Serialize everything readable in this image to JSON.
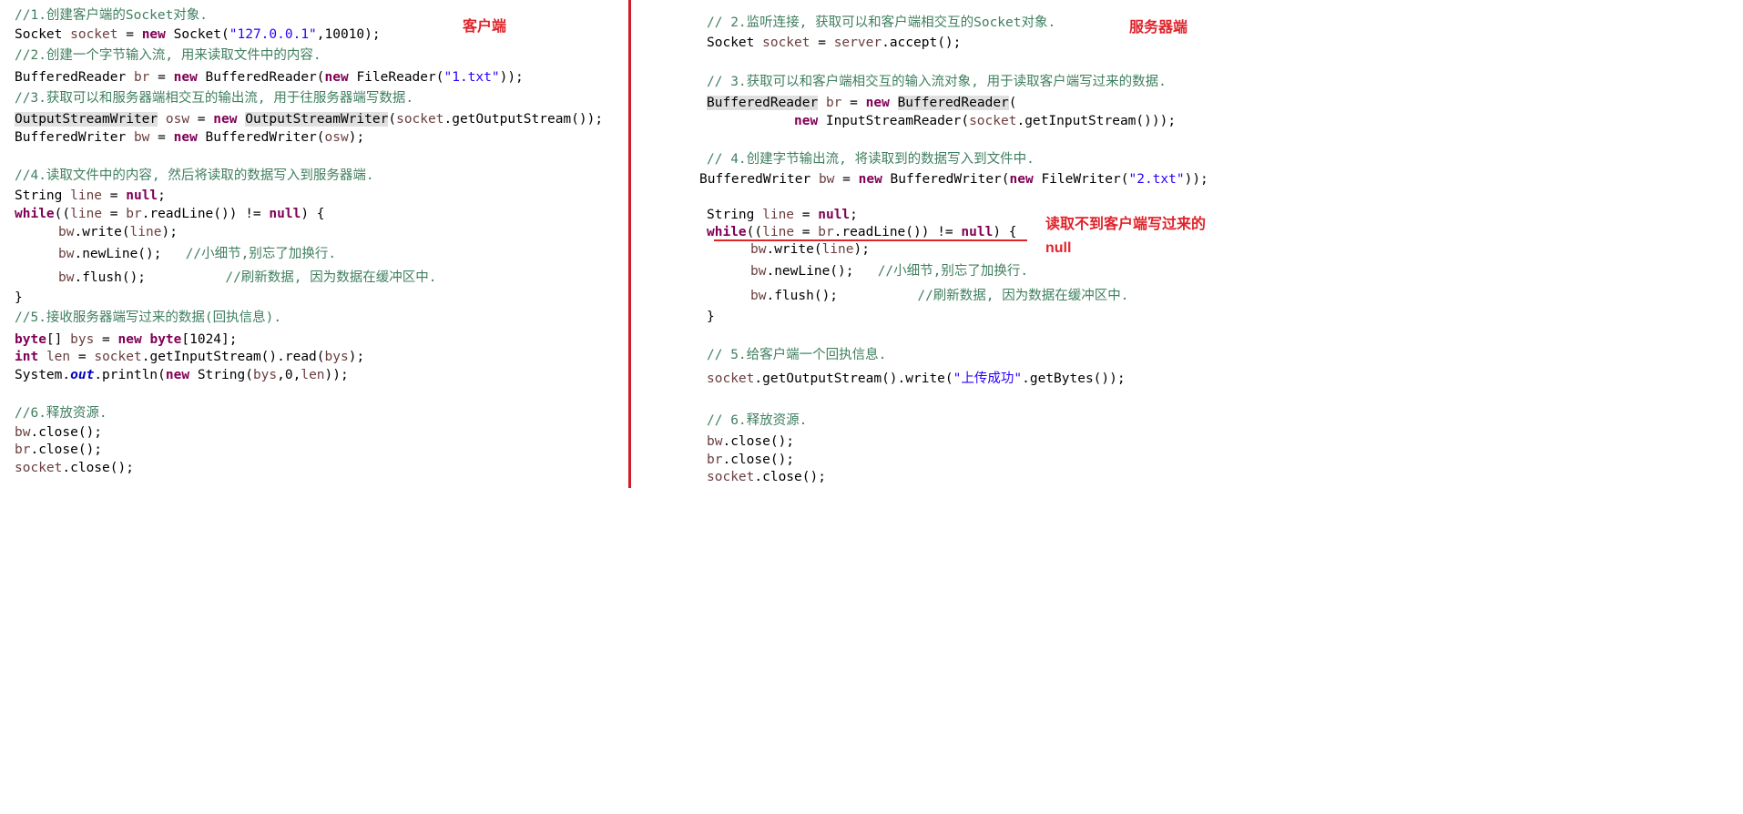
{
  "labels": {
    "client": "客户端",
    "server": "服务器端",
    "server_note": "读取不到客户端写过来的 null"
  },
  "colors": {
    "annotation": "#e0232b",
    "divider": "#d11b2a",
    "comment": "#3f7f5f",
    "keyword": "#7f0055",
    "string": "#2a00ff",
    "variable": "#6a3e3e",
    "static_field": "#0000c0"
  },
  "client_lines": [
    {
      "tokens": [
        {
          "t": "//1.创建客户端的Socket对象.",
          "c": "c"
        }
      ]
    },
    {
      "tokens": [
        {
          "t": "Socket ",
          "c": "p"
        },
        {
          "t": "socket",
          "c": "v"
        },
        {
          "t": " = ",
          "c": "p"
        },
        {
          "t": "new",
          "c": "k"
        },
        {
          "t": " Socket(",
          "c": "p"
        },
        {
          "t": "\"127.0.0.1\"",
          "c": "s"
        },
        {
          "t": ",10010);",
          "c": "p"
        }
      ]
    },
    {
      "tokens": [
        {
          "t": "//2.创建一个字节输入流, 用来读取文件中的内容.",
          "c": "c"
        }
      ]
    },
    {
      "tokens": [
        {
          "t": "BufferedReader ",
          "c": "p"
        },
        {
          "t": "br",
          "c": "v"
        },
        {
          "t": " = ",
          "c": "p"
        },
        {
          "t": "new",
          "c": "k"
        },
        {
          "t": " BufferedReader(",
          "c": "p"
        },
        {
          "t": "new",
          "c": "k"
        },
        {
          "t": " FileReader(",
          "c": "p"
        },
        {
          "t": "\"1.txt\"",
          "c": "s"
        },
        {
          "t": "));",
          "c": "p"
        }
      ]
    },
    {
      "tokens": [
        {
          "t": "//3.获取可以和服务器端相交互的输出流, 用于往服务器端写数据.",
          "c": "c"
        }
      ]
    },
    {
      "tokens": [
        {
          "t": "OutputStreamWriter",
          "c": "hl"
        },
        {
          "t": " ",
          "c": "p"
        },
        {
          "t": "osw",
          "c": "v"
        },
        {
          "t": " = ",
          "c": "p"
        },
        {
          "t": "new",
          "c": "k"
        },
        {
          "t": " ",
          "c": "p"
        },
        {
          "t": "OutputStreamWriter",
          "c": "hl"
        },
        {
          "t": "(",
          "c": "p"
        },
        {
          "t": "socket",
          "c": "v"
        },
        {
          "t": ".getOutputStream());",
          "c": "p"
        }
      ]
    },
    {
      "tokens": [
        {
          "t": "BufferedWriter ",
          "c": "p"
        },
        {
          "t": "bw",
          "c": "v"
        },
        {
          "t": " = ",
          "c": "p"
        },
        {
          "t": "new",
          "c": "k"
        },
        {
          "t": " BufferedWriter(",
          "c": "p"
        },
        {
          "t": "osw",
          "c": "v"
        },
        {
          "t": ");",
          "c": "p"
        }
      ]
    },
    {
      "tokens": [
        {
          "t": "//4.读取文件中的内容, 然后将读取的数据写入到服务器端.",
          "c": "c"
        }
      ]
    },
    {
      "tokens": [
        {
          "t": "String ",
          "c": "p"
        },
        {
          "t": "line",
          "c": "v"
        },
        {
          "t": " = ",
          "c": "p"
        },
        {
          "t": "null",
          "c": "k"
        },
        {
          "t": ";",
          "c": "p"
        }
      ]
    },
    {
      "tokens": [
        {
          "t": "while",
          "c": "k"
        },
        {
          "t": "((",
          "c": "p"
        },
        {
          "t": "line",
          "c": "v"
        },
        {
          "t": " = ",
          "c": "p"
        },
        {
          "t": "br",
          "c": "v"
        },
        {
          "t": ".readLine()) != ",
          "c": "p"
        },
        {
          "t": "null",
          "c": "k"
        },
        {
          "t": ") {",
          "c": "p"
        }
      ]
    },
    {
      "tokens": [
        {
          "t": "bw",
          "c": "v"
        },
        {
          "t": ".write(",
          "c": "p"
        },
        {
          "t": "line",
          "c": "v"
        },
        {
          "t": ");",
          "c": "p"
        }
      ]
    },
    {
      "tokens": [
        {
          "t": "bw",
          "c": "v"
        },
        {
          "t": ".newLine();   ",
          "c": "p"
        },
        {
          "t": "//小细节,别忘了加换行.",
          "c": "c"
        }
      ]
    },
    {
      "tokens": [
        {
          "t": "bw",
          "c": "v"
        },
        {
          "t": ".flush();          ",
          "c": "p"
        },
        {
          "t": "//刷新数据, 因为数据在缓冲区中.",
          "c": "c"
        }
      ]
    },
    {
      "tokens": [
        {
          "t": "}",
          "c": "p"
        }
      ]
    },
    {
      "tokens": [
        {
          "t": "//5.接收服务器端写过来的数据(回执信息).",
          "c": "c"
        }
      ]
    },
    {
      "tokens": [
        {
          "t": "byte",
          "c": "k"
        },
        {
          "t": "[] ",
          "c": "p"
        },
        {
          "t": "bys",
          "c": "v"
        },
        {
          "t": " = ",
          "c": "p"
        },
        {
          "t": "new",
          "c": "k"
        },
        {
          "t": " ",
          "c": "p"
        },
        {
          "t": "byte",
          "c": "k"
        },
        {
          "t": "[1024];",
          "c": "p"
        }
      ]
    },
    {
      "tokens": [
        {
          "t": "int",
          "c": "k"
        },
        {
          "t": " ",
          "c": "p"
        },
        {
          "t": "len",
          "c": "v"
        },
        {
          "t": " = ",
          "c": "p"
        },
        {
          "t": "socket",
          "c": "v"
        },
        {
          "t": ".getInputStream().read(",
          "c": "p"
        },
        {
          "t": "bys",
          "c": "v"
        },
        {
          "t": ");",
          "c": "p"
        }
      ]
    },
    {
      "tokens": [
        {
          "t": "System.",
          "c": "p"
        },
        {
          "t": "out",
          "c": "f"
        },
        {
          "t": ".println(",
          "c": "p"
        },
        {
          "t": "new",
          "c": "k"
        },
        {
          "t": " String(",
          "c": "p"
        },
        {
          "t": "bys",
          "c": "v"
        },
        {
          "t": ",0,",
          "c": "p"
        },
        {
          "t": "len",
          "c": "v"
        },
        {
          "t": "));",
          "c": "p"
        }
      ]
    },
    {
      "tokens": [
        {
          "t": "//6.释放资源.",
          "c": "c"
        }
      ]
    },
    {
      "tokens": [
        {
          "t": "bw",
          "c": "v"
        },
        {
          "t": ".close();",
          "c": "p"
        }
      ]
    },
    {
      "tokens": [
        {
          "t": "br",
          "c": "v"
        },
        {
          "t": ".close();",
          "c": "p"
        }
      ]
    },
    {
      "tokens": [
        {
          "t": "socket",
          "c": "v"
        },
        {
          "t": ".close();",
          "c": "p"
        }
      ]
    }
  ],
  "server_lines": [
    {
      "tokens": [
        {
          "t": "// 2.监听连接, 获取可以和客户端相交互的Socket对象.",
          "c": "c"
        }
      ]
    },
    {
      "tokens": [
        {
          "t": "Socket ",
          "c": "p"
        },
        {
          "t": "socket",
          "c": "v"
        },
        {
          "t": " = ",
          "c": "p"
        },
        {
          "t": "server",
          "c": "v"
        },
        {
          "t": ".accept();",
          "c": "p"
        }
      ]
    },
    {
      "tokens": [
        {
          "t": "// 3.获取可以和客户端相交互的输入流对象, 用于读取客户端写过来的数据.",
          "c": "c"
        }
      ]
    },
    {
      "tokens": [
        {
          "t": "BufferedReader",
          "c": "hl"
        },
        {
          "t": " ",
          "c": "p"
        },
        {
          "t": "br",
          "c": "v"
        },
        {
          "t": " = ",
          "c": "p"
        },
        {
          "t": "new",
          "c": "k"
        },
        {
          "t": " ",
          "c": "p"
        },
        {
          "t": "BufferedReader",
          "c": "hl"
        },
        {
          "t": "(",
          "c": "p"
        }
      ]
    },
    {
      "tokens": [
        {
          "t": "new",
          "c": "k"
        },
        {
          "t": " InputStreamReader(",
          "c": "p"
        },
        {
          "t": "socket",
          "c": "v"
        },
        {
          "t": ".getInputStream()));",
          "c": "p"
        }
      ]
    },
    {
      "tokens": [
        {
          "t": "// 4.创建字节输出流, 将读取到的数据写入到文件中.",
          "c": "c"
        }
      ]
    },
    {
      "tokens": [
        {
          "t": "BufferedWriter ",
          "c": "p"
        },
        {
          "t": "bw",
          "c": "v"
        },
        {
          "t": " = ",
          "c": "p"
        },
        {
          "t": "new",
          "c": "k"
        },
        {
          "t": " BufferedWriter(",
          "c": "p"
        },
        {
          "t": "new",
          "c": "k"
        },
        {
          "t": " FileWriter(",
          "c": "p"
        },
        {
          "t": "\"2.txt\"",
          "c": "s"
        },
        {
          "t": "));",
          "c": "p"
        }
      ]
    },
    {
      "tokens": [
        {
          "t": "String ",
          "c": "p"
        },
        {
          "t": "line",
          "c": "v"
        },
        {
          "t": " = ",
          "c": "p"
        },
        {
          "t": "null",
          "c": "k"
        },
        {
          "t": ";",
          "c": "p"
        }
      ]
    },
    {
      "tokens": [
        {
          "t": "while",
          "c": "k"
        },
        {
          "t": "((",
          "c": "p"
        },
        {
          "t": "line",
          "c": "v"
        },
        {
          "t": " = ",
          "c": "p"
        },
        {
          "t": "br",
          "c": "v"
        },
        {
          "t": ".readLine()) != ",
          "c": "p"
        },
        {
          "t": "null",
          "c": "k"
        },
        {
          "t": ") {",
          "c": "p"
        }
      ]
    },
    {
      "tokens": [
        {
          "t": "bw",
          "c": "v"
        },
        {
          "t": ".write(",
          "c": "p"
        },
        {
          "t": "line",
          "c": "v"
        },
        {
          "t": ");",
          "c": "p"
        }
      ]
    },
    {
      "tokens": [
        {
          "t": "bw",
          "c": "v"
        },
        {
          "t": ".newLine();   ",
          "c": "p"
        },
        {
          "t": "//小细节,别忘了加换行.",
          "c": "c"
        }
      ]
    },
    {
      "tokens": [
        {
          "t": "bw",
          "c": "v"
        },
        {
          "t": ".flush();          ",
          "c": "p"
        },
        {
          "t": "//刷新数据, 因为数据在缓冲区中.",
          "c": "c"
        }
      ]
    },
    {
      "tokens": [
        {
          "t": "}",
          "c": "p"
        }
      ]
    },
    {
      "tokens": [
        {
          "t": "// 5.给客户端一个回执信息.",
          "c": "c"
        }
      ]
    },
    {
      "tokens": [
        {
          "t": "socket",
          "c": "v"
        },
        {
          "t": ".getOutputStream().write(",
          "c": "p"
        },
        {
          "t": "\"上传成功\"",
          "c": "s"
        },
        {
          "t": ".getBytes());",
          "c": "p"
        }
      ]
    },
    {
      "tokens": [
        {
          "t": "// 6.释放资源.",
          "c": "c"
        }
      ]
    },
    {
      "tokens": [
        {
          "t": "bw",
          "c": "v"
        },
        {
          "t": ".close();",
          "c": "p"
        }
      ]
    },
    {
      "tokens": [
        {
          "t": "br",
          "c": "v"
        },
        {
          "t": ".close();",
          "c": "p"
        }
      ]
    },
    {
      "tokens": [
        {
          "t": "socket",
          "c": "v"
        },
        {
          "t": ".close();",
          "c": "p"
        }
      ]
    }
  ]
}
